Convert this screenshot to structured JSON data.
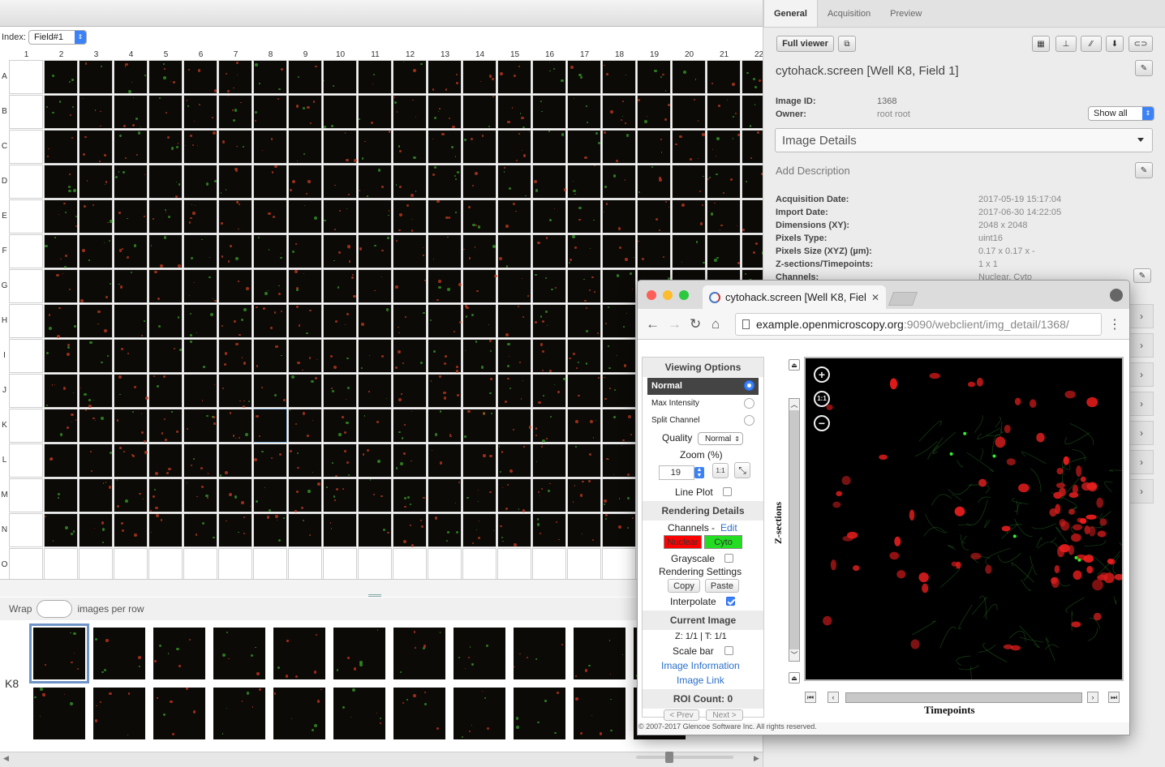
{
  "index_bar": {
    "label": "Index:",
    "field": "Field#1"
  },
  "plate": {
    "columns": [
      "1",
      "2",
      "3",
      "4",
      "5",
      "6",
      "7",
      "8",
      "9",
      "10",
      "11",
      "12",
      "13",
      "14",
      "15",
      "16",
      "17",
      "18",
      "19",
      "20",
      "21",
      "22"
    ],
    "rows": [
      "A",
      "B",
      "C",
      "D",
      "E",
      "F",
      "G",
      "H",
      "I",
      "J",
      "K",
      "L",
      "M",
      "N",
      "O"
    ]
  },
  "wrap": {
    "label_before": "Wrap",
    "label_after": "images per row"
  },
  "well_label": "K8",
  "tabs": [
    "General",
    "Acquisition",
    "Preview"
  ],
  "general": {
    "full_viewer": "Full viewer",
    "image_name": "cytohack.screen [Well K8, Field 1]",
    "image_id_label": "Image ID:",
    "image_id": "1368",
    "owner_label": "Owner:",
    "owner": "root root",
    "show_all": "Show all",
    "image_details": "Image Details",
    "add_description": "Add Description",
    "meta": [
      {
        "k": "Acquisition Date:",
        "v": "2017-05-19 15:17:04"
      },
      {
        "k": "Import Date:",
        "v": "2017-06-30 14:22:05"
      },
      {
        "k": "Dimensions (XY):",
        "v": "2048 x 2048"
      },
      {
        "k": "Pixels Type:",
        "v": "uint16"
      },
      {
        "k": "Pixels Size (XYZ) (µm):",
        "v": "0.17 x 0.17 x -"
      },
      {
        "k": "Z-sections/Timepoints:",
        "v": "1 x 1"
      },
      {
        "k": "Channels:",
        "v": "Nuclear, Cyto"
      }
    ]
  },
  "browser": {
    "tab_title": "cytohack.screen [Well K8, Fiel",
    "url_host": "example.openmicroscopy.org",
    "url_path": ":9090/webclient/img_detail/1368/"
  },
  "viewer": {
    "viewing_options": "Viewing Options",
    "modes": [
      "Normal",
      "Max Intensity",
      "Split Channel"
    ],
    "selected_mode": "Normal",
    "quality_label": "Quality",
    "quality": "Normal",
    "zoom_label": "Zoom (%)",
    "zoom": "19",
    "line_plot": "Line Plot",
    "rendering_details": "Rendering Details",
    "channels_label": "Channels -",
    "edit": "Edit",
    "channels": [
      {
        "name": "Nuclear",
        "color": "#ff0000"
      },
      {
        "name": "Cyto",
        "color": "#22dd22"
      }
    ],
    "grayscale": "Grayscale",
    "rendering_settings": "Rendering Settings",
    "copy": "Copy",
    "paste": "Paste",
    "interpolate": "Interpolate",
    "interpolate_on": true,
    "current_image": "Current Image",
    "zt": "Z: 1/1 | T: 1/1",
    "scale_bar": "Scale bar",
    "image_information": "Image Information",
    "image_link": "Image Link",
    "roi_count": "ROI Count: 0",
    "prev": "< Prev",
    "next": "Next >",
    "z_sections": "Z-sections",
    "timepoints": "Timepoints",
    "zoom_in": "+",
    "one_to_one": "1:1",
    "zoom_out": "−",
    "copyright": "© 2007-2017 Glencoe Software Inc. All rights reserved."
  }
}
